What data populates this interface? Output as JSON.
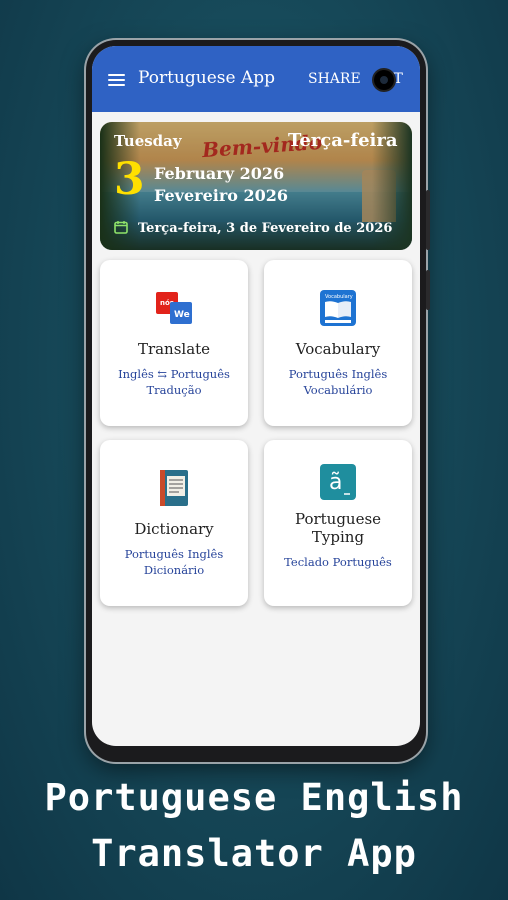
{
  "appbar": {
    "title": "Portuguese App",
    "share_label": "SHARE",
    "exit_label": "IT"
  },
  "banner": {
    "day_en": "Tuesday",
    "welcome": "Bem-vindo",
    "day_pt": "Terça-feira",
    "date": "3",
    "month_en": "February 2026",
    "month_pt": "Fevereiro 2026",
    "full_date": "Terça-feira, 3 de Fevereiro de 2026"
  },
  "cards": [
    {
      "title": "Translate",
      "sub1": "Inglês ⇆ Português",
      "sub2": "Tradução",
      "icon": "translate-icon"
    },
    {
      "title": "Vocabulary",
      "sub1": "Português Inglês",
      "sub2": "Vocabulário",
      "icon": "vocabulary-book-icon"
    },
    {
      "title": "Dictionary",
      "sub1": "Português Inglês",
      "sub2": "Dicionário",
      "icon": "dictionary-book-icon"
    },
    {
      "title_line1": "Portuguese",
      "title_line2": "Typing",
      "sub1": "Teclado Português",
      "icon": "keyboard-a-tilde-icon"
    }
  ],
  "caption": {
    "line1": "Portuguese English",
    "line2": "Translator App"
  },
  "colors": {
    "appbar": "#2f62c4",
    "date_yellow": "#ffe000",
    "subtitle_blue": "#27449a",
    "background": "#174a5a"
  }
}
